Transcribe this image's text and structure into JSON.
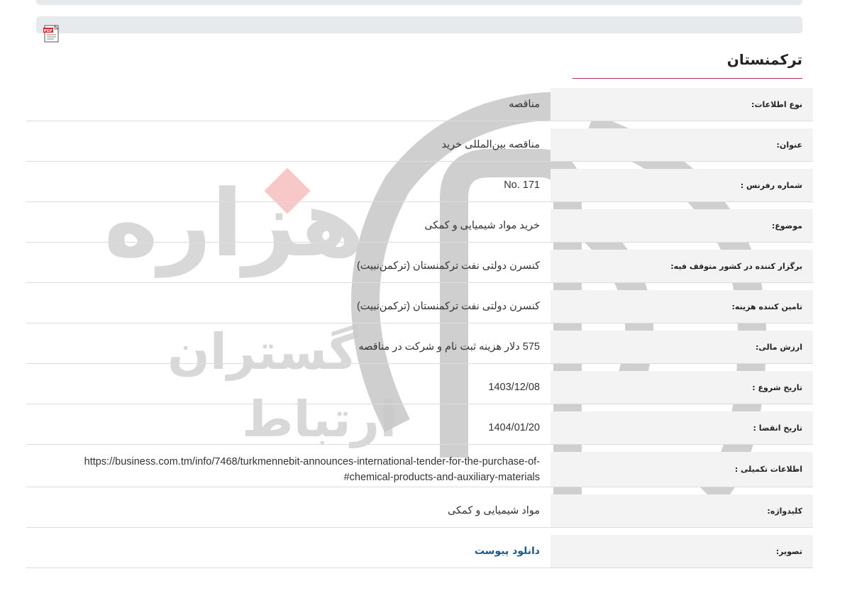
{
  "section": {
    "title": "ترکمنستان"
  },
  "toolbar": {
    "pdf_icon": "pdf-file-icon",
    "pdf_badge": "PDF"
  },
  "watermark": {
    "logo_text_main": "هزاره",
    "logo_text_sub1": "گستران",
    "logo_text_sub2": "ارتباط",
    "accent": "#f8c8c8"
  },
  "rows": [
    {
      "label": "نوع اطلاعات:",
      "value": "مناقصه"
    },
    {
      "label": "عنوان:",
      "value": "مناقصه بین‌المللی خرید"
    },
    {
      "label": "شماره رفرنس :",
      "value": "No. 171"
    },
    {
      "label": "موضوع:",
      "value": "خرید مواد شیمیایی و کمکی"
    },
    {
      "label": "برگزار کننده در کشور متوقف فیه:",
      "value": "کنسرن دولتی نفت ترکمنستان (ترکمن‌نبیت)"
    },
    {
      "label": "تامین کننده هزینه:",
      "value": "کنسرن دولتی نفت ترکمنستان (ترکمن‌نبیت)"
    },
    {
      "label": "ارزش مالی:",
      "value": "575 دلار هزینه ثبت نام و شرکت در مناقصه"
    },
    {
      "label": "تاریخ شروع :",
      "value": "1403/12/08"
    },
    {
      "label": "تاریخ انقضا :",
      "value": "1404/01/20"
    },
    {
      "label": "اطلاعات تکمیلی :",
      "value": "https://business.com.tm/info/7468/turkmennebit-announces-international-tender-for-the-purchase-of-#chemical-products-and-auxiliary-materials"
    },
    {
      "label": "کلیدواژه:",
      "value": "مواد شیمیایی و کمکی"
    },
    {
      "label": "تصویر:",
      "value": "دانلود پیوست"
    }
  ]
}
